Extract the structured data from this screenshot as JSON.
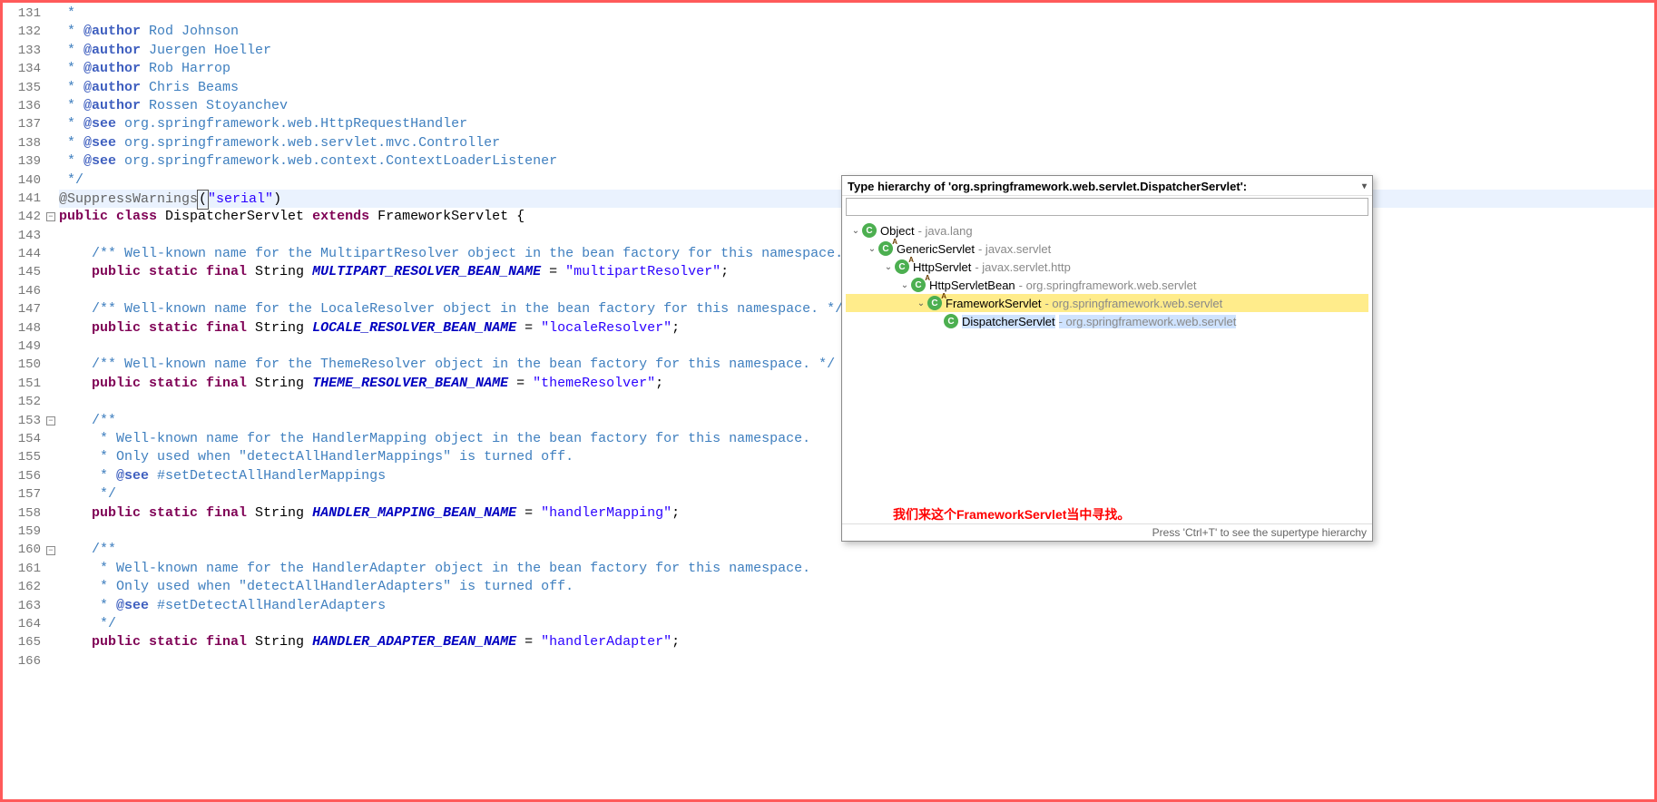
{
  "lines": {
    "start": 131,
    "count": 36
  },
  "code": {
    "l131": " *",
    "l132_pre": " * ",
    "l132_tag": "@author",
    "l132_rest": " Rod Johnson",
    "l133_tag": "@author",
    "l133_rest": " Juergen Hoeller",
    "l134_tag": "@author",
    "l134_rest": " Rob Harrop",
    "l135_tag": "@author",
    "l135_rest": " Chris Beams",
    "l136_tag": "@author",
    "l136_rest": " Rossen Stoyanchev",
    "l137_tag": "@see",
    "l137_rest": " org.springframework.web.HttpRequestHandler",
    "l138_tag": "@see",
    "l138_rest": " org.springframework.web.servlet.mvc.Controller",
    "l139_tag": "@see",
    "l139_rest": " org.springframework.web.context.ContextLoaderListener",
    "l140": " */",
    "l141_ann": "@SuppressWarnings",
    "l141_paren_open": "(",
    "l141_str": "\"serial\"",
    "l141_paren_close": ")",
    "l142_kw1": "public class ",
    "l142_name": "DispatcherServlet ",
    "l142_kw2": "extends ",
    "l142_parent": "FrameworkServlet {",
    "l144_c": "/** Well-known name for the MultipartResolver object in the bean factory for this namespace. */",
    "l145_kw": "public static final ",
    "l145_type": "String ",
    "l145_field": "MULTIPART_RESOLVER_BEAN_NAME",
    "l145_eq": " = ",
    "l145_str": "\"multipartResolver\"",
    "l145_semi": ";",
    "l147_c": "/** Well-known name for the LocaleResolver object in the bean factory for this namespace. */",
    "l148_field": "LOCALE_RESOLVER_BEAN_NAME",
    "l148_str": "\"localeResolver\"",
    "l150_c": "/** Well-known name for the ThemeResolver object in the bean factory for this namespace. */",
    "l151_field": "THEME_RESOLVER_BEAN_NAME",
    "l151_str": "\"themeResolver\"",
    "l153_c1": "/**",
    "l154_c": " * Well-known name for the HandlerMapping object in the bean factory for this namespace.",
    "l155_c": " * Only used when \"detectAllHandlerMappings\" is turned off.",
    "l156_pre": " * ",
    "l156_tag": "@see",
    "l156_rest": " #setDetectAllHandlerMappings",
    "l157_c": " */",
    "l158_field": "HANDLER_MAPPING_BEAN_NAME",
    "l158_str": "\"handlerMapping\"",
    "l160_c1": "/**",
    "l161_c": " * Well-known name for the HandlerAdapter object in the bean factory for this namespace.",
    "l162_c": " * Only used when \"detectAllHandlerAdapters\" is turned off.",
    "l163_pre": " * ",
    "l163_tag": "@see",
    "l163_rest": " #setDetectAllHandlerAdapters",
    "l164_c": " */",
    "l165_field": "HANDLER_ADAPTER_BEAN_NAME",
    "l165_str": "\"handlerAdapter\""
  },
  "popup": {
    "title": "Type hierarchy of 'org.springframework.web.servlet.DispatcherServlet':",
    "filter_value": "",
    "menu_glyph": "▾",
    "status": "Press 'Ctrl+T' to see the supertype hierarchy",
    "nodes": [
      {
        "indent": 0,
        "twisty": "⌄",
        "ico": "class",
        "name": "Object",
        "pkg": "- java.lang"
      },
      {
        "indent": 1,
        "twisty": "⌄",
        "ico": "abs",
        "name": "GenericServlet",
        "pkg": "- javax.servlet"
      },
      {
        "indent": 2,
        "twisty": "⌄",
        "ico": "abs",
        "name": "HttpServlet",
        "pkg": "- javax.servlet.http"
      },
      {
        "indent": 3,
        "twisty": "⌄",
        "ico": "abs",
        "name": "HttpServletBean",
        "pkg": "- org.springframework.web.servlet"
      },
      {
        "indent": 4,
        "twisty": "⌄",
        "ico": "abs",
        "name": "FrameworkServlet",
        "pkg": "- org.springframework.web.servlet",
        "hi": true
      },
      {
        "indent": 5,
        "twisty": "",
        "ico": "sel",
        "name": "DispatcherServlet",
        "pkg": "- org.springframework.web.servlet",
        "sel": true
      }
    ],
    "annotation": "我们来这个FrameworkServlet当中寻找。"
  }
}
